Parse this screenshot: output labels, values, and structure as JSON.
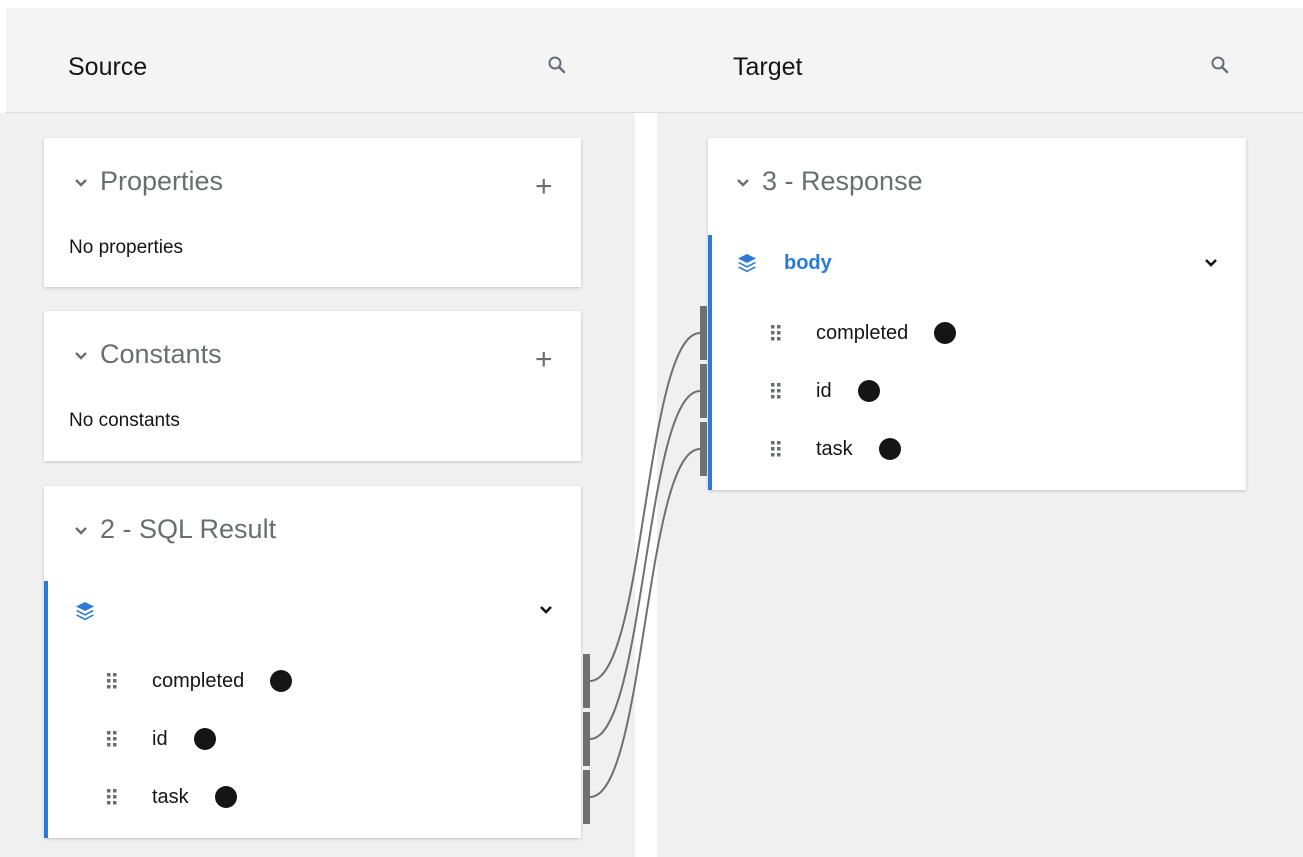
{
  "header": {
    "source_title": "Source",
    "target_title": "Target"
  },
  "source": {
    "properties": {
      "title": "Properties",
      "empty_text": "No properties"
    },
    "constants": {
      "title": "Constants",
      "empty_text": "No constants"
    },
    "sql_result": {
      "title": "2 - SQL Result",
      "fields": [
        {
          "name": "completed"
        },
        {
          "name": "id"
        },
        {
          "name": "task"
        }
      ]
    }
  },
  "target": {
    "response": {
      "title": "3 - Response",
      "group_label": "body",
      "fields": [
        {
          "name": "completed"
        },
        {
          "name": "id"
        },
        {
          "name": "task"
        }
      ]
    }
  },
  "icons": {
    "search": "search-icon",
    "chevron": "chevron-down-icon",
    "add": "plus-icon",
    "group": "layers-icon",
    "drag": "drag-handle-icon",
    "mapped": "mapped-dot-icon"
  },
  "colors": {
    "accent": "#2b7bd6",
    "header_bg": "#f4f4f4",
    "panel_bg": "#f0f0f0",
    "line": "#707070"
  }
}
